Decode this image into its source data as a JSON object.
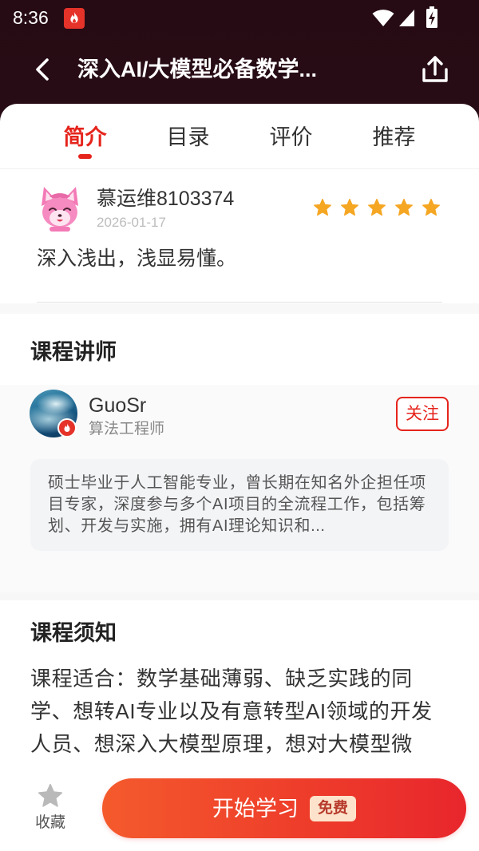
{
  "status_bar": {
    "time": "8:36"
  },
  "header": {
    "title": "深入AI/大模型必备数学..."
  },
  "tabs": [
    {
      "label": "简介",
      "active": true
    },
    {
      "label": "目录",
      "active": false
    },
    {
      "label": "评价",
      "active": false
    },
    {
      "label": "推荐",
      "active": false
    }
  ],
  "review": {
    "user": "慕运维8103374",
    "date": "2026-01-17",
    "rating": 5,
    "rating_max": 5,
    "text": "深入浅出，浅显易懂。"
  },
  "instructor_section": {
    "heading": "课程讲师",
    "name": "GuoSr",
    "role": "算法工程师",
    "follow_label": "关注",
    "bio": "硕士毕业于人工智能专业，曾长期在知名外企担任项目专家，深度参与多个AI项目的全流程工作，包括筹划、开发与实施，拥有AI理论知识和..."
  },
  "notice_section": {
    "heading": "课程须知",
    "text": "课程适合：数学基础薄弱、缺乏实践的同学、想转AI专业以及有意转型AI领域的开发人员、想深入大模型原理，想对大模型微"
  },
  "bottom_bar": {
    "favorite_label": "收藏",
    "start_label": "开始学习",
    "free_badge": "免费"
  },
  "colors": {
    "accent": "#e5241c",
    "star": "#f5a623",
    "star_empty": "#dddddd",
    "header_bg": "#2b0e17",
    "button_start": "#f45a2c",
    "button_end": "#e8262c"
  },
  "icons": {
    "back": "back-arrow-icon",
    "share": "share-icon",
    "star": "star-icon",
    "favorite": "favorite-star-icon",
    "app": "flame-icon"
  }
}
